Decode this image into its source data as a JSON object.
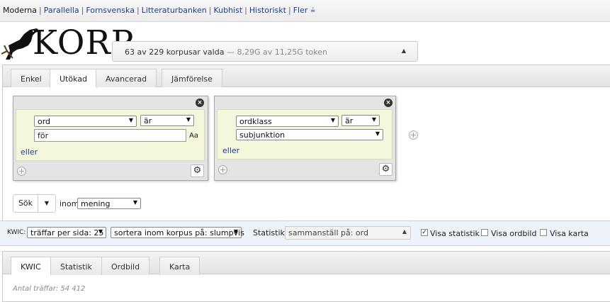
{
  "topnav": {
    "items": [
      {
        "label": "Moderna",
        "current": true
      },
      {
        "label": "Parallella"
      },
      {
        "label": "Fornsvenska"
      },
      {
        "label": "Litteraturbanken"
      },
      {
        "label": "Kubhist"
      },
      {
        "label": "Historiskt"
      },
      {
        "label": "Fler"
      }
    ],
    "more_icon": "double-chevron-down-icon"
  },
  "logo": {
    "text": "KORP"
  },
  "corpus": {
    "selected_text": "63 av 229 korpusar valda",
    "tokens_text": "— 8,29G av 11,25G token"
  },
  "query_tabs": [
    "Enkel",
    "Utökad",
    "Avancerad",
    "Jämförelse"
  ],
  "tokens": [
    {
      "attribute": "ord",
      "operator": "är",
      "value": "för",
      "case_label": "Aa",
      "or_label": "eller"
    },
    {
      "attribute": "ordklass",
      "operator": "är",
      "value": "subjunktion",
      "or_label": "eller"
    }
  ],
  "search": {
    "button_label": "Sök",
    "within_label": "inom",
    "within_value": "mening"
  },
  "options": {
    "kwic_label": "KWIC:",
    "hits_per_page": "träffar per sida: 25",
    "sort": "sortera inom korpus på: slumpvis",
    "stats_label": "Statistik:",
    "stats_value": "sammanställ på: ord",
    "show_stats": "Visa statistik",
    "show_wordpic": "Visa ordbild",
    "show_map": "Visa karta"
  },
  "result_tabs": [
    "KWIC",
    "Statistik",
    "Ordbild",
    "Karta"
  ],
  "results": {
    "count_text": "Antal träffar: 54 412"
  }
}
